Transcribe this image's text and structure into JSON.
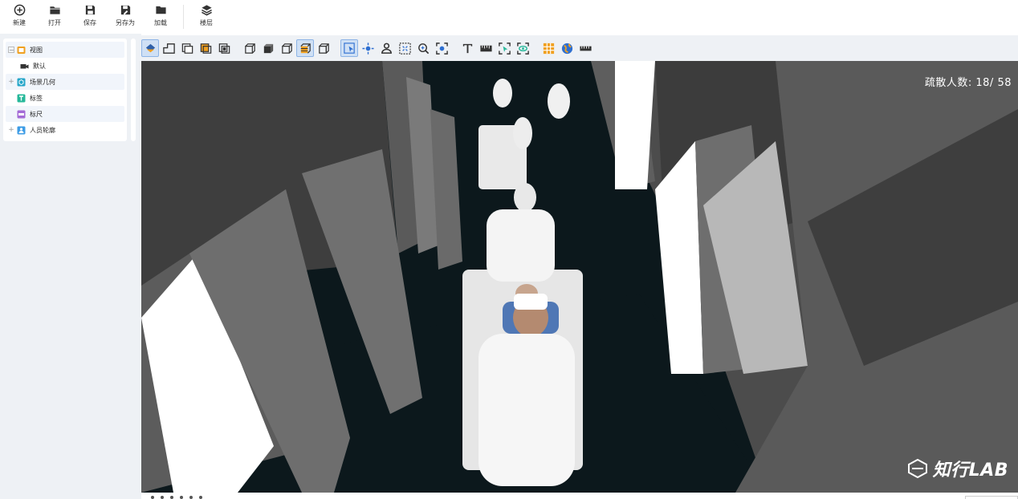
{
  "ribbon": {
    "items": [
      {
        "label": "新建",
        "icon": "new-plus-icon"
      },
      {
        "label": "打开",
        "icon": "folder-open-icon"
      },
      {
        "label": "保存",
        "icon": "save-disk-icon"
      },
      {
        "label": "另存为",
        "icon": "save-as-icon"
      },
      {
        "label": "加载",
        "icon": "load-folder-icon"
      },
      {
        "label": "楼层",
        "icon": "layers-icon"
      }
    ]
  },
  "tree": {
    "nodes": [
      {
        "label": "视图",
        "icon": "view-icon",
        "expander": "−",
        "color": "#f0a020"
      },
      {
        "label": "默认",
        "icon": "camera-icon",
        "expander": "",
        "color": "#333333"
      },
      {
        "label": "场景几何",
        "icon": "geometry-icon",
        "expander": "+",
        "color": "#26a6c9"
      },
      {
        "label": "标签",
        "icon": "text-label-icon",
        "expander": "",
        "color": "#26b89a"
      },
      {
        "label": "标尺",
        "icon": "ruler-icon",
        "expander": "",
        "color": "#a46bd6"
      },
      {
        "label": "人员轮廓",
        "icon": "person-outline-icon",
        "expander": "+",
        "color": "#3d9ce6"
      }
    ]
  },
  "viewport": {
    "counter_label": "疏散人数: ",
    "counter_value": "18/ 58",
    "brand_text": "知行LAB",
    "colors": {
      "wall_dark": "#3a3a3a",
      "wall_mid": "#646464",
      "wall_light": "#ffffff",
      "floor": "#0c181c",
      "accent": "#f0a020"
    }
  }
}
